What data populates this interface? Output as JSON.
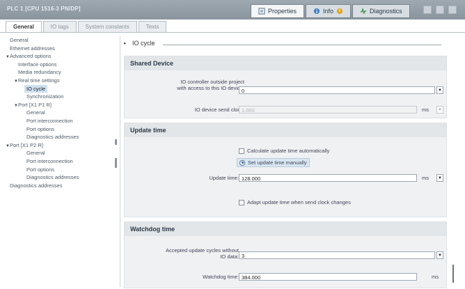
{
  "window": {
    "title": "PLC 1 [CPU 1516-3 PN/DP]",
    "tabs": [
      {
        "label": "Properties",
        "icon": "properties-icon",
        "active": true
      },
      {
        "label": "Info",
        "icon": "info-icon",
        "active": false
      },
      {
        "label": "Diagnostics",
        "icon": "diagnostics-icon",
        "active": false
      }
    ]
  },
  "subtabs": [
    {
      "label": "General",
      "active": true
    },
    {
      "label": "IO tags",
      "active": false
    },
    {
      "label": "System constants",
      "active": false
    },
    {
      "label": "Texts",
      "active": false
    }
  ],
  "nav": [
    {
      "label": "General",
      "level": 0,
      "arrow": ""
    },
    {
      "label": "Ethernet addresses",
      "level": 0,
      "arrow": ""
    },
    {
      "label": "Advanced options",
      "level": 0,
      "arrow": "▼"
    },
    {
      "label": "Interface options",
      "level": 1,
      "arrow": ""
    },
    {
      "label": "Media redundancy",
      "level": 1,
      "arrow": ""
    },
    {
      "label": "Real time settings",
      "level": 1,
      "arrow": "▼"
    },
    {
      "label": "IO cycle",
      "level": 2,
      "arrow": "",
      "selected": true
    },
    {
      "label": "Synchronization",
      "level": 2,
      "arrow": ""
    },
    {
      "label": "Port [X1 P1 R]",
      "level": 1,
      "arrow": "▼"
    },
    {
      "label": "General",
      "level": 2,
      "arrow": ""
    },
    {
      "label": "Port interconnection",
      "level": 2,
      "arrow": ""
    },
    {
      "label": "Port options",
      "level": 2,
      "arrow": ""
    },
    {
      "label": "Diagnostics addresses",
      "level": 2,
      "arrow": ""
    },
    {
      "label": "Port [X1 P2 R]",
      "level": 1,
      "arrow": "▼"
    },
    {
      "label": "General",
      "level": 2,
      "arrow": ""
    },
    {
      "label": "Port interconnection",
      "level": 2,
      "arrow": ""
    },
    {
      "label": "Port options",
      "level": 2,
      "arrow": ""
    },
    {
      "label": "Diagnostics addresses",
      "level": 2,
      "arrow": ""
    },
    {
      "label": "Diagnostics addresses",
      "level": 0,
      "arrow": ""
    }
  ],
  "section": {
    "title": "IO cycle"
  },
  "shared_device": {
    "heading": "Shared Device",
    "controller_label_1": "IO controller outside project",
    "controller_label_2": "with access to this IO device:",
    "controller_value": "0",
    "send_clock_label": "IO device send clock:",
    "send_clock_value": "1.000",
    "send_clock_unit": "ms"
  },
  "update_time": {
    "heading": "Update time",
    "auto_label": "Calculate update time automatically",
    "manual_label": "Set update time manually",
    "manual_selected": true,
    "field_label": "Update time:",
    "field_value": "128.000",
    "unit": "ms",
    "adapt_label": "Adapt update time when send clock changes"
  },
  "watchdog": {
    "heading": "Watchdog time",
    "cycles_label_1": "Accepted update cycles without",
    "cycles_label_2": "IO data:",
    "cycles_value": "3",
    "time_label": "Watchdog time:",
    "time_value": "384.000",
    "unit": "ms"
  }
}
